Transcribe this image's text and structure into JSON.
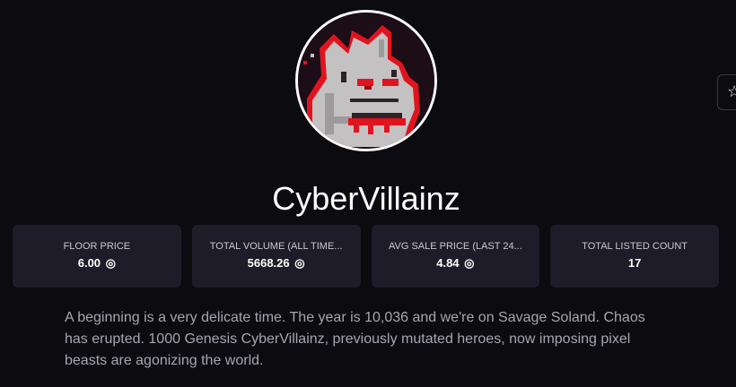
{
  "collection": {
    "name": "CyberVillainz",
    "description": "A beginning is a very delicate time. The year is 10,036 and we're on Savage Soland. Chaos has erupted. 1000 Genesis CyberVillainz, previously mutated heroes, now imposing pixel beasts are agonizing the world."
  },
  "icons": {
    "favorite": "star-outline-icon",
    "currency": "sol-currency-icon",
    "currency_glyph": "◎"
  },
  "stats": [
    {
      "label": "FLOOR PRICE",
      "value": "6.00",
      "has_currency": true
    },
    {
      "label": "TOTAL VOLUME (ALL TIME...",
      "value": "5668.26",
      "has_currency": true
    },
    {
      "label": "AVG SALE PRICE (LAST 24...",
      "value": "4.84",
      "has_currency": true
    },
    {
      "label": "TOTAL LISTED COUNT",
      "value": "17",
      "has_currency": false
    }
  ],
  "colors": {
    "background": "#0c0b10",
    "card": "#1d1c28",
    "avatar_accent": "#e0141e"
  }
}
